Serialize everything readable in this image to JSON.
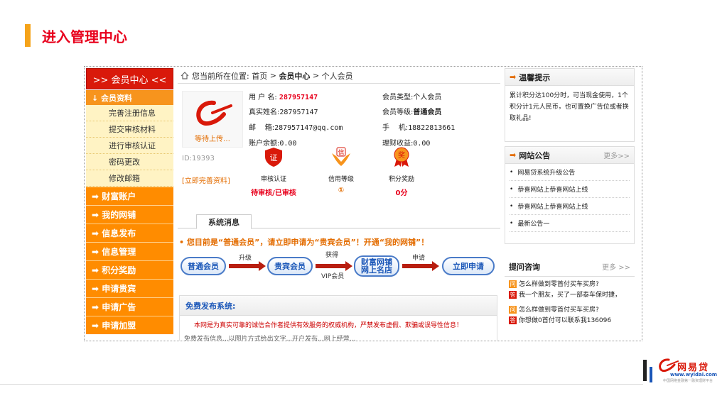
{
  "slide": {
    "title": "进入管理中心"
  },
  "sidebar": {
    "header": ">> 会员中心 <<",
    "category": "↓ 会员资料",
    "subitems": [
      "完善注册信息",
      "提交审核材料",
      "进行审核认证",
      "密码更改",
      "修改邮箱"
    ],
    "items": [
      "➡ 财富账户",
      "➡ 我的网铺",
      "➡ 信息发布",
      "➡ 信息管理",
      "➡ 积分奖励",
      "➡ 申请贵宾",
      "➡ 申请广告",
      "➡ 申请加盟"
    ]
  },
  "breadcrumb": {
    "prefix": "您当前所在位置:",
    "home": "首页",
    "sep1": ">",
    "center": "会员中心",
    "sep2": ">",
    "current": "个人会员"
  },
  "profile": {
    "avatar_label": "等待上传…",
    "uid": "ID:19393",
    "complete_link": "[立即完善资料]",
    "fields": {
      "username_label": "用 户 名:",
      "username": "287957147",
      "member_type_label": "会员类型:",
      "member_type": "个人会员",
      "realname_label": "真实姓名:",
      "realname": "287957147",
      "member_level_label": "会员等级:",
      "member_level": "普通会员",
      "email_label": "邮    箱:",
      "email": "287957147@qq.com",
      "mobile_label": "手    机:",
      "mobile": "18822813661",
      "balance_label": "账户余额:",
      "balance": "0.00",
      "earnings_label": "理财收益:",
      "earnings": "0.00"
    },
    "badges": [
      {
        "icon": "certificate-icon",
        "label": "审核认证",
        "status": "待审核/已审核"
      },
      {
        "icon": "credit-hands-icon",
        "label": "信用等级",
        "status": "①"
      },
      {
        "icon": "reward-medal-icon",
        "label": "积分奖励",
        "status": "0分"
      }
    ],
    "badge_icon_texts": [
      "证",
      "信",
      "奖"
    ]
  },
  "tabs": {
    "system_message": "系统消息"
  },
  "notice": "• 您目前是“普通会员”，请立即申请为“贵宾会员”！开通“我的网铺”！",
  "flow": {
    "step1": "普通会员",
    "arrow1": "升级",
    "step2": "贵宾会员",
    "arrow2_top": "获得",
    "arrow2_bottom": "VIP会员",
    "step3_line1": "财富网铺",
    "step3_line2": "网上名店",
    "arrow3": "申请",
    "step4": "立即申请"
  },
  "free_publish": {
    "title": "免费发布系统:",
    "text": "本网是为真实可靠的诚信合作者提供有效服务的权威机构，严禁发布虚假、欺骗或误导性信息！",
    "text2": "免费发布信息...以图片方式给出文字...开户发布...网上经营..."
  },
  "tips": {
    "title": "温馨提示",
    "text": "累计积分达100分时，可当现金使用，1个积分计1元人民币，也可置换广告位或者换取礼品!"
  },
  "announcements": {
    "title": "网站公告",
    "more": "更多>>",
    "items": [
      "网易贷系统升级公告",
      "恭喜网站上恭喜网站上线",
      "恭喜网站上恭喜网站上线",
      "最新公告一"
    ]
  },
  "qa": {
    "title": "提问咨询",
    "more": "更多 >>",
    "items": [
      {
        "q": "怎么样做到零首付买车买房?",
        "a": "我一个朋友，买了一部泰车保时捷，"
      },
      {
        "q": "怎么样做到零首付买车买房?",
        "a": "你想做0首付可以联系我136096"
      }
    ],
    "q_mark": "问",
    "a_mark": "答"
  },
  "brand": {
    "name": "网易贷",
    "url": "www.wyidai.com",
    "sub": "中国网络金融第一融资理财平台"
  },
  "colors": {
    "accent_red": "#e8001c",
    "sidebar_orange": "#ff8c00",
    "slide_bar": "#f5a31a",
    "link_blue": "#1a56b8"
  }
}
